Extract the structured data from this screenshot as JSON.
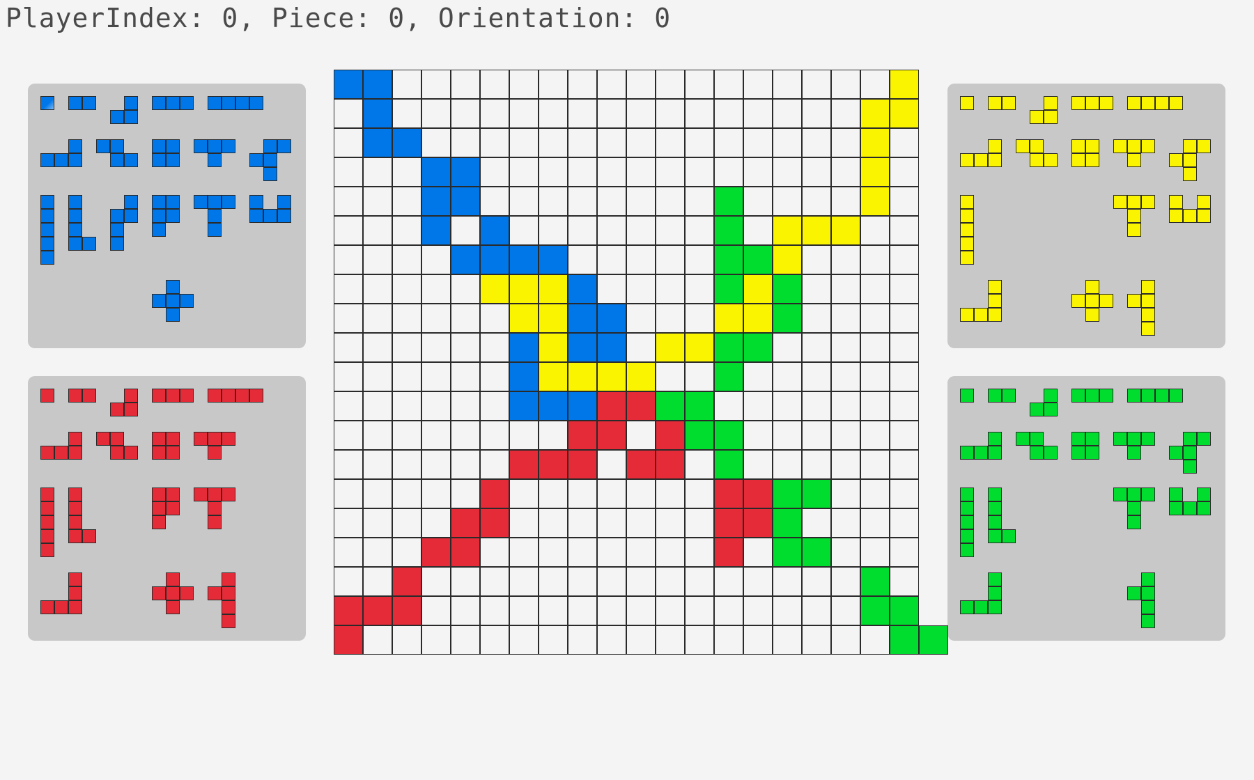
{
  "status": "PlayerIndex: 0, Piece: 0, Orientation: 0",
  "colors": {
    "empty": "#f4f4f4",
    "blue": "#0077e8",
    "yellow": "#fbf400",
    "green": "#00dd2e",
    "red": "#e52b38",
    "panel": "#c8c8c8",
    "grid_line": "#2a2a2a"
  },
  "board": {
    "size": 20,
    "rows": [
      "BB.................Y",
      ".B................YY",
      ".BB...............Y.",
      "...BB.............Y.",
      "...BB........G....Y.",
      "...B.B.......G.YYY..",
      "....BBBB.....GGY....",
      ".....YYYB....GYG....",
      "......YYBB...YYG....",
      "......BYBB.YYGG.....",
      "......BYYYY..G......",
      "......BBBRRGG.......",
      "........RR.RGG......",
      "......RRR.RR.G......",
      ".....R.......RRGG...",
      "....RR.......RRG....",
      "...RR........R.GG...",
      "..R...............G.",
      "RRR...............GG",
      "R..................GG"
    ]
  },
  "panels": {
    "blue": {
      "color": "blue",
      "selected_piece": 0,
      "remaining": [
        0,
        1,
        2,
        3,
        4,
        5,
        6,
        7,
        8,
        9,
        10,
        11,
        12,
        13,
        14,
        15,
        20
      ]
    },
    "yellow": {
      "color": "yellow",
      "remaining": [
        0,
        1,
        2,
        3,
        4,
        5,
        6,
        7,
        8,
        9,
        10,
        14,
        15,
        16,
        19,
        20
      ]
    },
    "red": {
      "color": "red",
      "remaining": [
        0,
        1,
        2,
        3,
        4,
        5,
        6,
        7,
        8,
        10,
        11,
        13,
        14,
        16,
        19,
        20
      ]
    },
    "green": {
      "color": "green",
      "remaining": [
        0,
        1,
        2,
        3,
        4,
        5,
        6,
        7,
        8,
        9,
        10,
        11,
        14,
        15,
        16,
        19
      ]
    }
  }
}
